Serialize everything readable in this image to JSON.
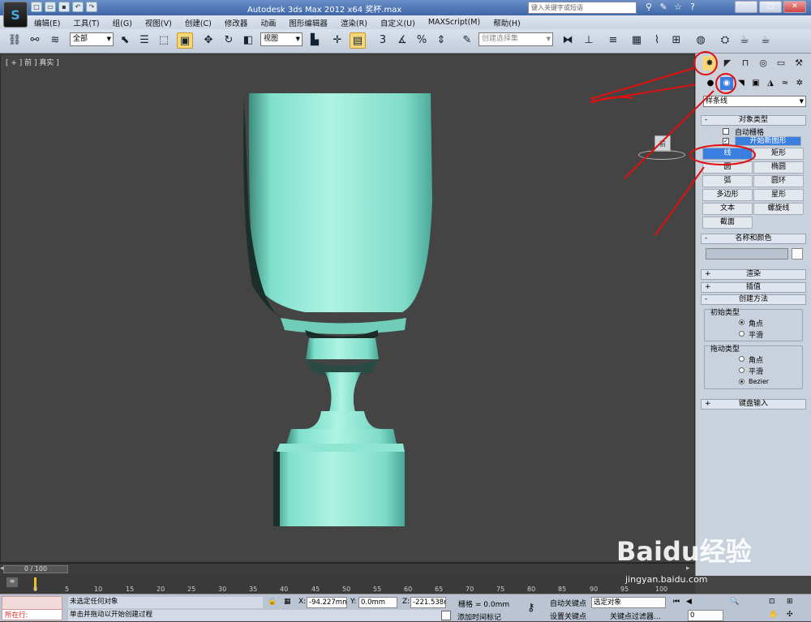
{
  "title": "Autodesk 3ds Max  2012 x64   奖杯.max",
  "search_placeholder": "键入关键字或短语",
  "menu": [
    "编辑(E)",
    "工具(T)",
    "组(G)",
    "视图(V)",
    "创建(C)",
    "修改器",
    "动画",
    "图形编辑器",
    "渲染(R)",
    "自定义(U)",
    "MAXScript(M)",
    "帮助(H)"
  ],
  "toolbar": {
    "filter_value": "全部",
    "ref_coord_value": "视图",
    "selection_set_placeholder": "创建选择集",
    "snap_value": "3"
  },
  "viewport": {
    "label": "[ + ] 前 ] 真实 ]",
    "viewcube_label": "前",
    "object_color": "#7fe0cc"
  },
  "command_panel": {
    "category_value": "样条线",
    "object_type_title": "对象类型",
    "autogrid_label": "自动栅格",
    "start_new_shape_label": "开始新图形",
    "start_new_shape_checked": true,
    "buttons": [
      "线",
      "矩形",
      "圆",
      "椭圆",
      "弧",
      "圆环",
      "多边形",
      "星形",
      "文本",
      "螺旋线",
      "截面"
    ],
    "selected_button": "线",
    "name_color_title": "名称和颜色",
    "render_title": "渲染",
    "interpolation_title": "插值",
    "creation_method_title": "创建方法",
    "initial_type_label": "初始类型",
    "initial_options": [
      "角点",
      "平滑"
    ],
    "initial_selected": "角点",
    "drag_type_label": "拖动类型",
    "drag_options": [
      "角点",
      "平滑",
      "Bezier"
    ],
    "drag_selected": "Bezier",
    "keyboard_entry_title": "键盘输入"
  },
  "timeslider": {
    "frame_label": "0 / 100"
  },
  "ruler_ticks": [
    "0",
    "5",
    "10",
    "15",
    "20",
    "25",
    "30",
    "35",
    "40",
    "45",
    "50",
    "55",
    "60",
    "65",
    "70",
    "75",
    "80",
    "85",
    "90",
    "95",
    "100"
  ],
  "status": {
    "running_label": "所在行:",
    "selection_status": "未选定任何对象",
    "prompt": "单击并拖动以开始创建过程",
    "x_label": "X:",
    "x_value": "-94.227mm",
    "y_label": "Y:",
    "y_value": "0.0mm",
    "z_label": "Z:",
    "z_value": "-221.538m",
    "grid_label": "栅格 = 0.0mm",
    "add_time_tag": "添加时间标记",
    "auto_key_label": "自动关键点",
    "set_key_label": "设置关键点",
    "key_mode_value": "选定对象",
    "key_filters_label": "关键点过滤器...",
    "frame_value": "0"
  },
  "watermark": {
    "brand": "Baidu经验",
    "url": "jingyan.baidu.com"
  },
  "colors": {
    "highlight_red": "#e01010",
    "selection_blue": "#3a7ee0",
    "panel_bg": "#c9d1dd",
    "viewport_bg": "#444444"
  }
}
